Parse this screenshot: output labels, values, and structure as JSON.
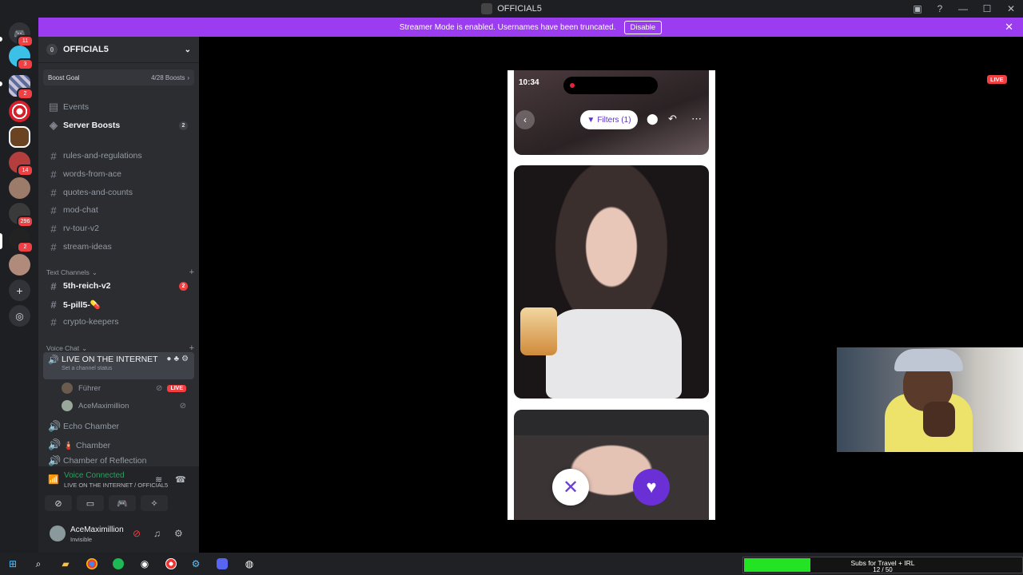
{
  "window": {
    "title": "OFFICIAL5"
  },
  "banner": {
    "message": "Streamer Mode is enabled. Usernames have been truncated.",
    "disable_label": "Disable"
  },
  "guilds": [
    {
      "badge": "11"
    },
    {
      "badge": "3"
    },
    {
      "badge": "2"
    },
    {
      "badge": ""
    },
    {
      "badge": ""
    },
    {
      "badge": "14"
    },
    {
      "badge": ""
    },
    {
      "badge": "296"
    },
    {
      "badge": "2"
    },
    {
      "badge": ""
    }
  ],
  "server": {
    "name": "OFFICIAL5",
    "boost_goal_label": "Boost Goal",
    "boost_progress": "4/28 Boosts",
    "events_label": "Events",
    "server_boosts_label": "Server Boosts",
    "server_boosts_count": "2"
  },
  "channels": [
    {
      "name": "rules-and-regulations"
    },
    {
      "name": "words-from-ace"
    },
    {
      "name": "quotes-and-counts"
    },
    {
      "name": "mod-chat"
    },
    {
      "name": "rv-tour-v2"
    },
    {
      "name": "stream-ideas"
    }
  ],
  "text_category": "Text Channels",
  "text_channels": [
    {
      "name": "5th-reich-v2",
      "count": "2"
    },
    {
      "name": "5-pill5-💊"
    },
    {
      "name": "crypto-keepers"
    }
  ],
  "voice_category": "Voice Chat",
  "active_voice": {
    "name": "LIVE ON THE INTERNET",
    "status": "Set a channel status",
    "users": [
      {
        "name": "Führer",
        "live": "LIVE"
      },
      {
        "name": "AceMaximillion"
      }
    ]
  },
  "voice_channels": [
    {
      "name": "Echo Chamber"
    },
    {
      "name": "🧯 Chamber"
    },
    {
      "name": "Chamber of Reflection"
    }
  ],
  "voice_connected": {
    "title": "Voice Connected",
    "subtitle": "LIVE ON THE INTERNET / OFFICIAL5"
  },
  "user": {
    "name": "AceMaximillion",
    "status": "Invisible"
  },
  "stream": {
    "live_tag": "LIVE",
    "phone_time": "10:34",
    "filters_label": "Filters (1)"
  },
  "subs_goal": {
    "title": "Subs for Travel + IRL",
    "progress": "12 / 50",
    "fraction": 0.24
  },
  "colors": {
    "accent": "#9b3cf0",
    "live_red": "#f23f43",
    "voice_green": "#23a559",
    "subs_bar": "#22e422"
  }
}
